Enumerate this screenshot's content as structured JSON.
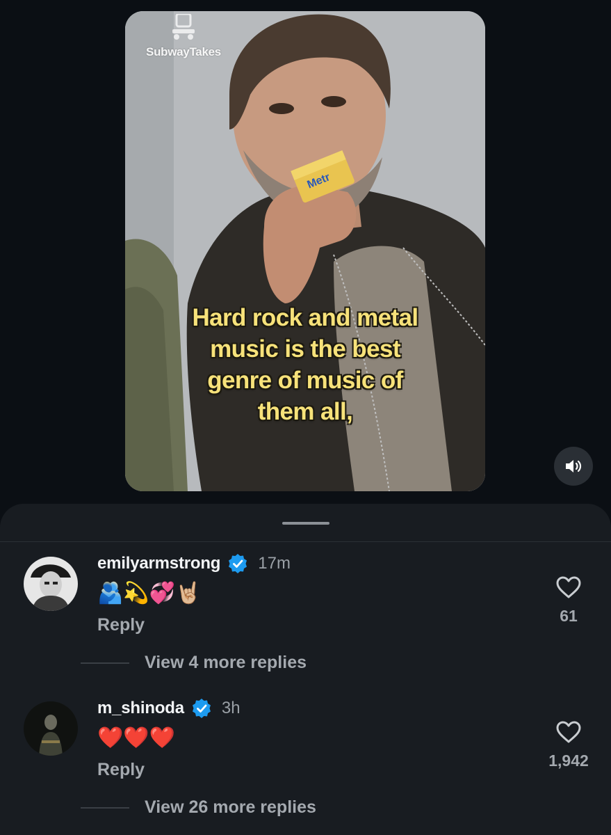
{
  "video": {
    "watermark": "SubwayTakes",
    "caption": "Hard rock and metal\nmusic is the best\ngenre of music of\nthem all,",
    "card_label": "Metr"
  },
  "volume": {
    "icon": "speaker-icon"
  },
  "comments": [
    {
      "username": "emilyarmstrong",
      "verified": true,
      "time": "17m",
      "text": "🫂💫💞🤘🏼",
      "reply_label": "Reply",
      "likes": "61",
      "view_replies": "View 4 more replies"
    },
    {
      "username": "m_shinoda",
      "verified": true,
      "time": "3h",
      "text": "❤️❤️❤️",
      "reply_label": "Reply",
      "likes": "1,942",
      "view_replies": "View 26 more replies"
    }
  ],
  "colors": {
    "background": "#0b0f14",
    "sheet": "#181c21",
    "verified": "#1d9bf0",
    "caption": "#f7e27a",
    "muted_text": "#a4a9af"
  }
}
